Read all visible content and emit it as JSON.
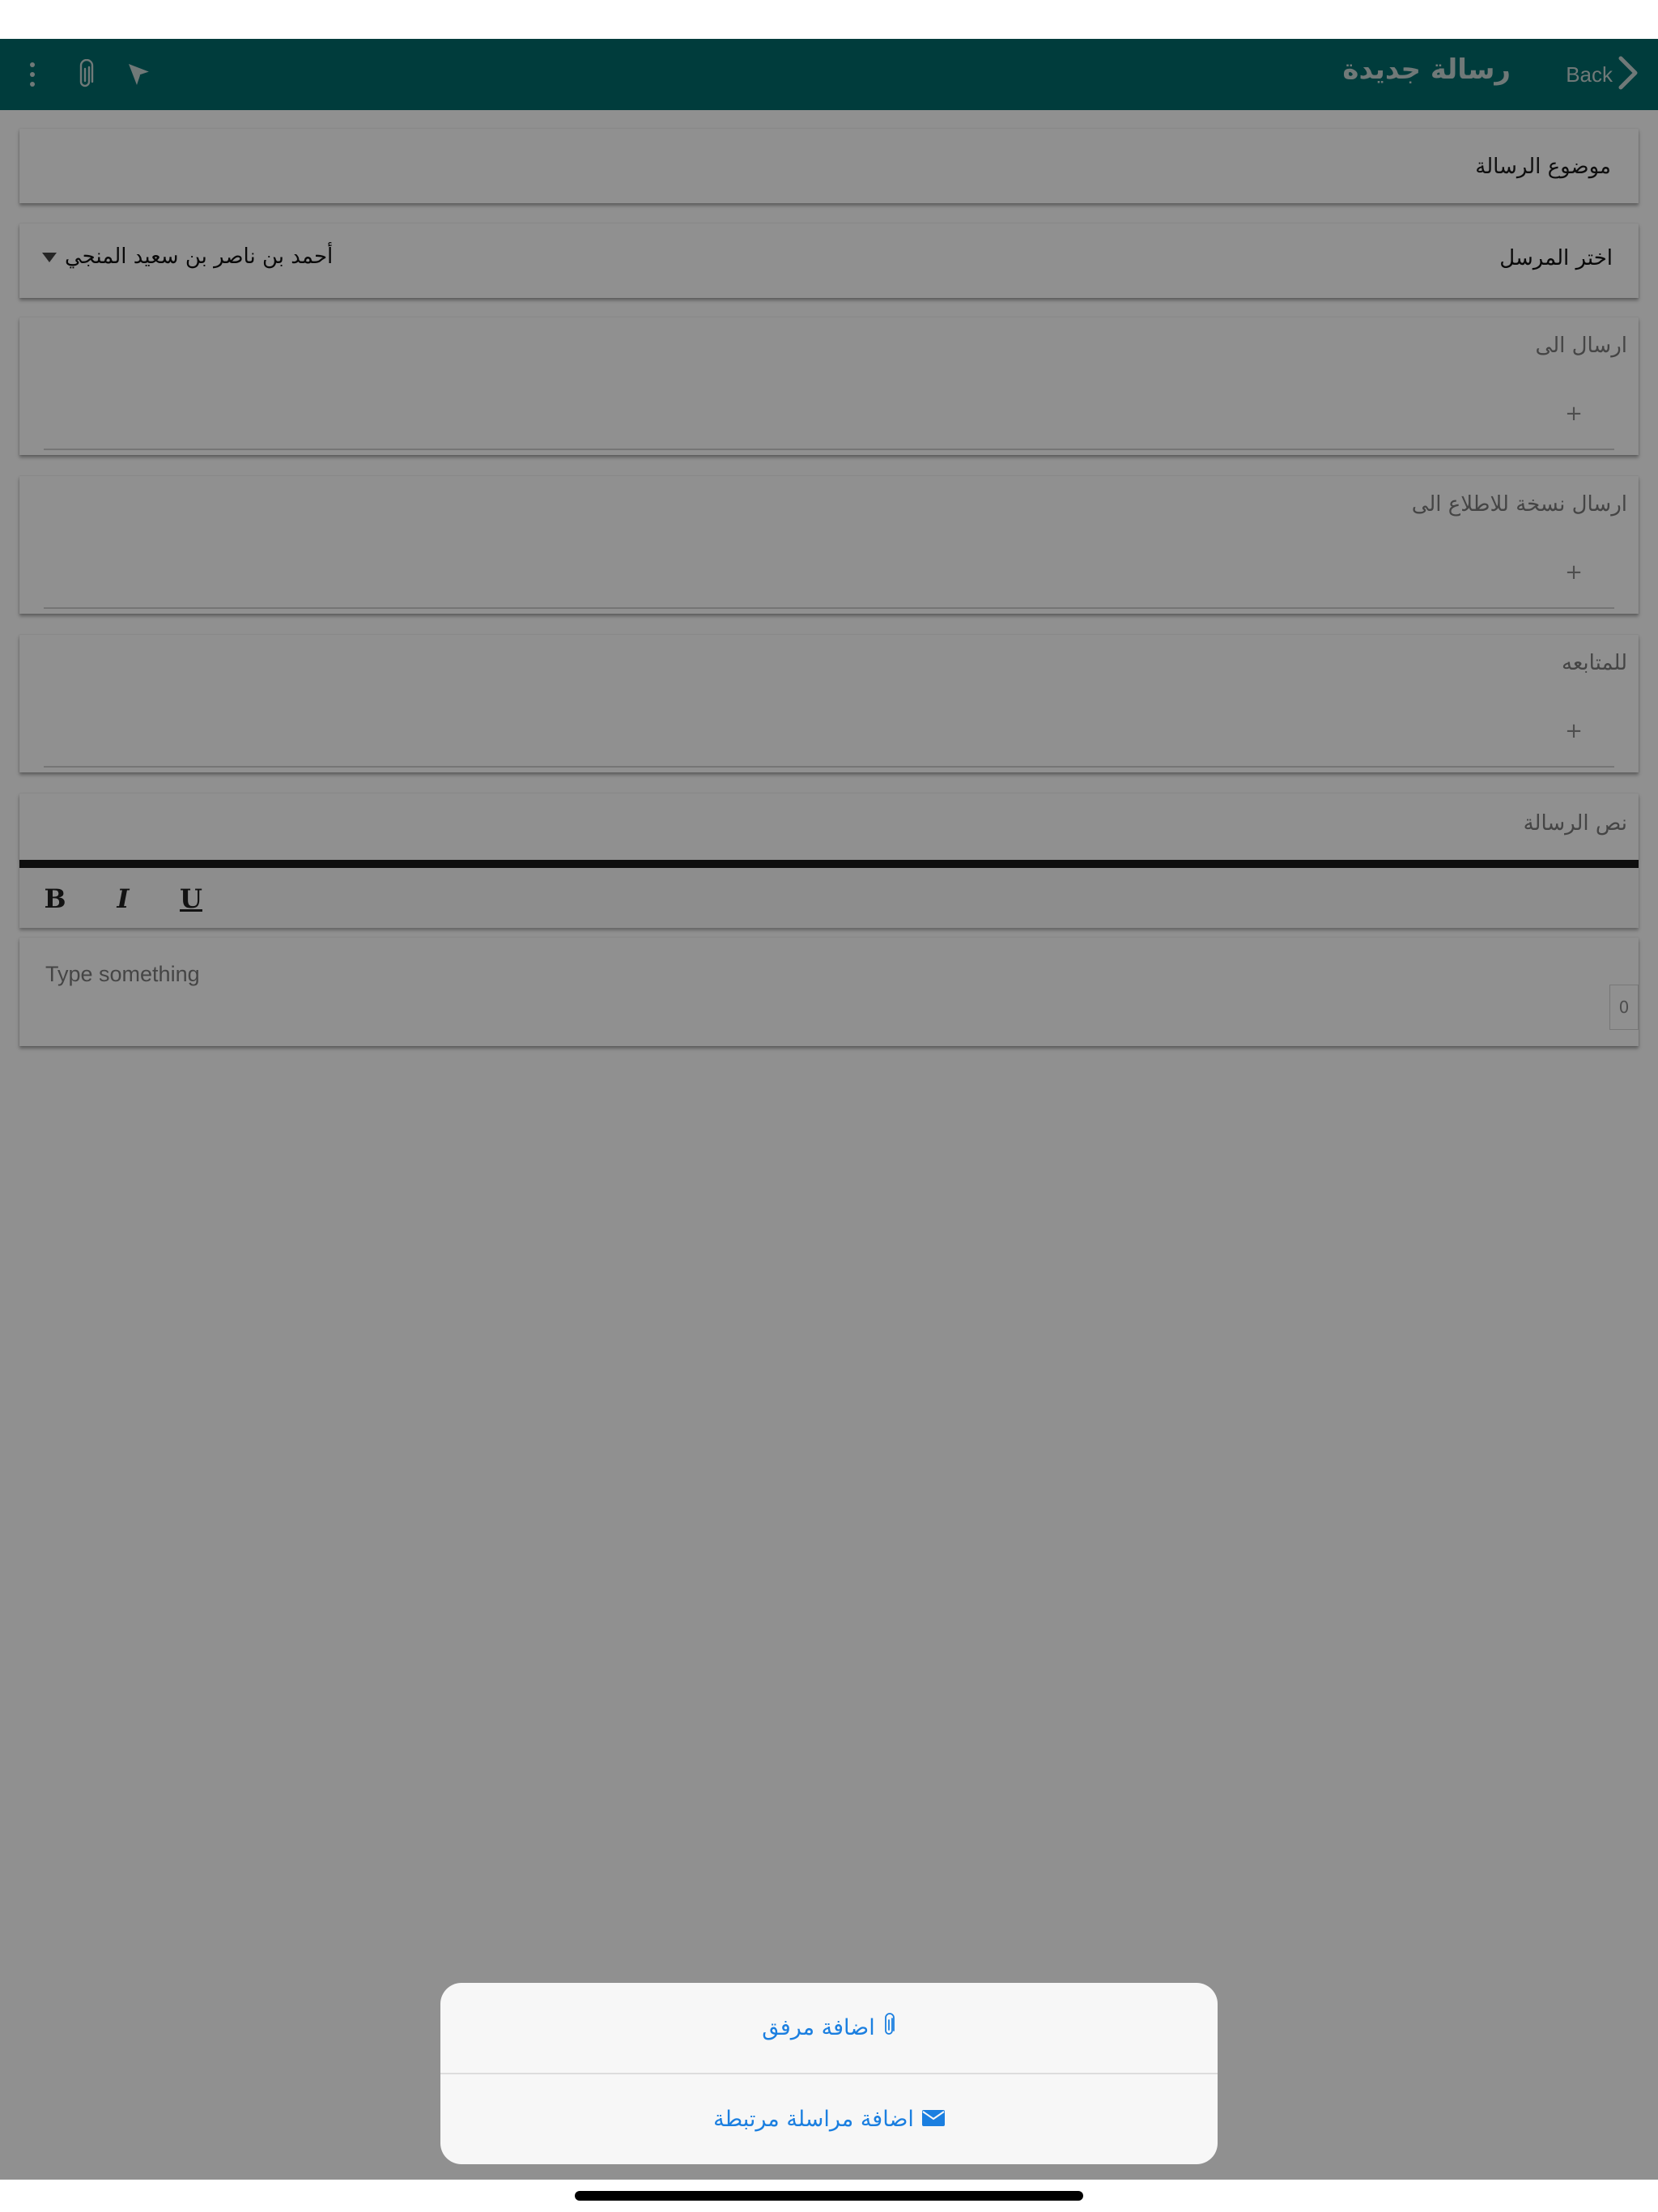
{
  "nav": {
    "back_label": "Back",
    "title": "رسالة جديدة",
    "bg_color": "#006b6b",
    "actions": [
      "send-icon",
      "attach-icon",
      "more-vertical-icon"
    ]
  },
  "form": {
    "subject_placeholder": "موضوع الرسالة",
    "sender_label": "اختر المرسل",
    "sender_value": "أحمد بن ناصر بن سعيد المنجي",
    "to_label": "ارسال الى",
    "cc_label": "ارسال نسخة للاطلاع الى",
    "follow_label": "للمتابعه",
    "add_symbol": "+",
    "body_label": "نص الرسالة"
  },
  "editor": {
    "bold": "B",
    "italic": "I",
    "underline": "U",
    "placeholder": "Type something",
    "counter": "0"
  },
  "sheet": {
    "add_attachment": "اضافة مرفق",
    "add_linked": "اضافة مراسلة مرتبطة",
    "accent_color": "#1b7fe0"
  }
}
